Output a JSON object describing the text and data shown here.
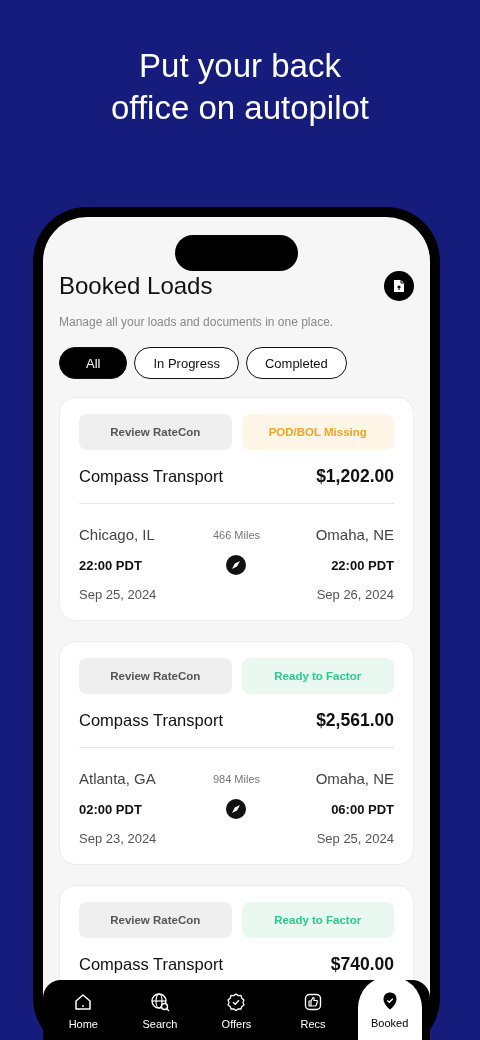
{
  "headline": "Put your back\noffice on autopilot",
  "screen": {
    "title": "Booked Loads",
    "subtitle": "Manage all your loads and documents in one place."
  },
  "filters": [
    {
      "label": "All",
      "selected": true
    },
    {
      "label": "In Progress",
      "selected": false
    },
    {
      "label": "Completed",
      "selected": false
    }
  ],
  "loads": [
    {
      "review_label": "Review RateCon",
      "status": {
        "label": "POD/BOL Missing",
        "kind": "warning"
      },
      "company": "Compass Transport",
      "price": "$1,202.00",
      "origin": "Chicago, IL",
      "distance": "466 Miles",
      "destination": "Omaha, NE",
      "depart_time": "22:00 PDT",
      "arrive_time": "22:00 PDT",
      "depart_date": "Sep 25, 2024",
      "arrive_date": "Sep 26, 2024"
    },
    {
      "review_label": "Review RateCon",
      "status": {
        "label": "Ready to Factor",
        "kind": "ready"
      },
      "company": "Compass Transport",
      "price": "$2,561.00",
      "origin": "Atlanta, GA",
      "distance": "984 Miles",
      "destination": "Omaha, NE",
      "depart_time": "02:00 PDT",
      "arrive_time": "06:00 PDT",
      "depart_date": "Sep 23, 2024",
      "arrive_date": "Sep 25, 2024"
    },
    {
      "review_label": "Review RateCon",
      "status": {
        "label": "Ready to Factor",
        "kind": "ready"
      },
      "company": "Compass Transport",
      "price": "$740.00"
    }
  ],
  "nav": [
    {
      "label": "Home",
      "selected": false
    },
    {
      "label": "Search",
      "selected": false
    },
    {
      "label": "Offers",
      "selected": false
    },
    {
      "label": "Recs",
      "selected": false
    },
    {
      "label": "Booked",
      "selected": true
    }
  ]
}
